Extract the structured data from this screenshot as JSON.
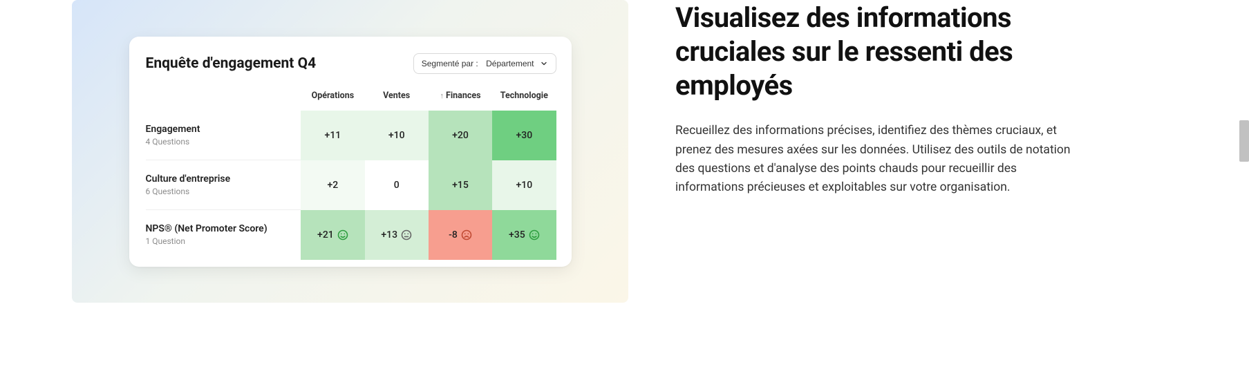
{
  "card": {
    "title": "Enquête d'engagement Q4",
    "segment_label": "Segmenté par :",
    "segment_value": "Département",
    "columns": [
      "Opérations",
      "Ventes",
      "Finances",
      "Technologie"
    ],
    "sort_column_index": 2,
    "rows": [
      {
        "title": "Engagement",
        "subtitle": "4 Questions",
        "cells": [
          {
            "label": "+11",
            "tone": "cell-g1"
          },
          {
            "label": "+10",
            "tone": "cell-g1"
          },
          {
            "label": "+20",
            "tone": "cell-g3"
          },
          {
            "label": "+30",
            "tone": "cell-g5"
          }
        ]
      },
      {
        "title": "Culture d'entreprise",
        "subtitle": "6 Questions",
        "cells": [
          {
            "label": "+2",
            "tone": "cell-g0"
          },
          {
            "label": "0",
            "tone": "cell-white"
          },
          {
            "label": "+15",
            "tone": "cell-g3"
          },
          {
            "label": "+10",
            "tone": "cell-g1"
          }
        ]
      },
      {
        "title": "NPS® (Net Promoter Score)",
        "subtitle": "1 Question",
        "cells": [
          {
            "label": "+21",
            "tone": "cell-g3",
            "face": "smile"
          },
          {
            "label": "+13",
            "tone": "cell-g2",
            "face": "neutral"
          },
          {
            "label": "-8",
            "tone": "cell-red",
            "face": "sad"
          },
          {
            "label": "+35",
            "tone": "cell-g4",
            "face": "smile"
          }
        ]
      }
    ]
  },
  "right": {
    "heading": "Visualisez des informations cruciales sur le ressenti des employés",
    "body": "Recueillez des informations précises, identifiez des thèmes cruciaux, et prenez des mesures axées sur les données. Utilisez des outils de notation des questions et d'analyse des points chauds pour recueillir des informations précieuses et exploitables sur votre organisation."
  },
  "chart_data": {
    "type": "heatmap",
    "title": "Enquête d'engagement Q4",
    "segment_by": "Département",
    "columns": [
      "Opérations",
      "Ventes",
      "Finances",
      "Technologie"
    ],
    "rows": [
      "Engagement",
      "Culture d'entreprise",
      "NPS® (Net Promoter Score)"
    ],
    "values": [
      [
        11,
        10,
        20,
        30
      ],
      [
        2,
        0,
        15,
        10
      ],
      [
        21,
        13,
        -8,
        35
      ]
    ],
    "row_meta": [
      {
        "question_count": 4
      },
      {
        "question_count": 6
      },
      {
        "question_count": 1
      }
    ]
  }
}
